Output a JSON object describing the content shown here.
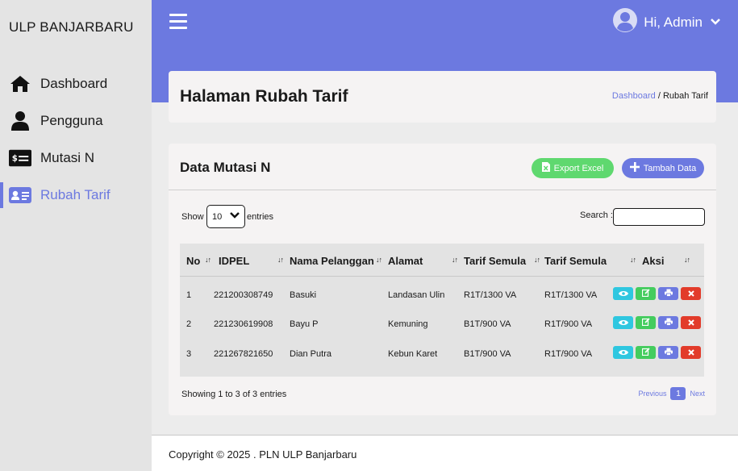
{
  "sidebar": {
    "brand": "ULP BANJARBARU",
    "items": [
      {
        "label": "Dashboard",
        "icon": "home-icon"
      },
      {
        "label": "Pengguna",
        "icon": "user-icon"
      },
      {
        "label": "Mutasi N",
        "icon": "money-icon"
      },
      {
        "label": "Rubah Tarif",
        "icon": "id-card-icon",
        "active": true
      }
    ]
  },
  "header": {
    "greeting": "Hi, Admin"
  },
  "page": {
    "title": "Halaman Rubah Tarif",
    "breadcrumb": {
      "link": "Dashboard",
      "separator": "/",
      "current": "Rubah Tarif"
    }
  },
  "data_card": {
    "title": "Data Mutasi N",
    "export_label": "Export Excel",
    "add_label": "Tambah Data",
    "show_label": "Show",
    "entries_value": "10",
    "entries_label": "entries",
    "search_label": "Search :",
    "search_value": ""
  },
  "table": {
    "columns": [
      "No",
      "IDPEL",
      "Nama Pelanggan",
      "Alamat",
      "Tarif Semula",
      "Tarif Semula",
      "Aksi"
    ],
    "rows": [
      {
        "no": "1",
        "idpel": "221200308749",
        "nama": "Basuki",
        "alamat": "Landasan Ulin",
        "tarif1": "R1T/1300 VA",
        "tarif2": "R1T/1300 VA"
      },
      {
        "no": "2",
        "idpel": "221230619908",
        "nama": "Bayu P",
        "alamat": "Kemuning",
        "tarif1": "B1T/900 VA",
        "tarif2": "R1T/900 VA"
      },
      {
        "no": "3",
        "idpel": "221267821650",
        "nama": "Dian Putra",
        "alamat": "Kebun Karet",
        "tarif1": "B1T/900 VA",
        "tarif2": "R1T/900 VA"
      }
    ]
  },
  "footer": {
    "showing": "Showing 1 to 3 of 3 entries",
    "previous": "Previous",
    "page": "1",
    "next": "Next",
    "copyright": "Copyright © 2025 . PLN ULP Banjarbaru"
  },
  "colors": {
    "accent": "#6c79e0",
    "export": "#5fd86f",
    "view": "#2fc7e0",
    "edit": "#44cc5e",
    "delete": "#e23b2a"
  }
}
